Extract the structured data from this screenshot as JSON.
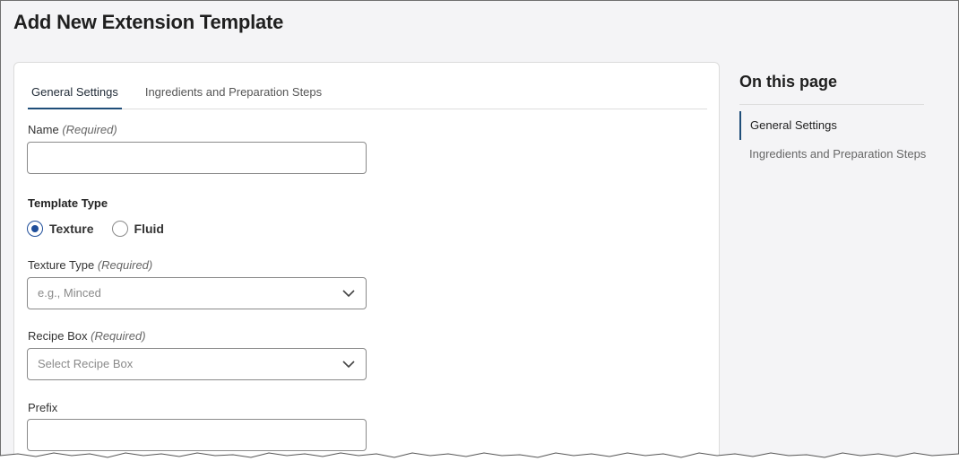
{
  "page": {
    "title": "Add New Extension Template"
  },
  "tabs": [
    {
      "label": "General Settings",
      "active": true
    },
    {
      "label": "Ingredients and Preparation Steps",
      "active": false
    }
  ],
  "form": {
    "name": {
      "label": "Name",
      "required": "(Required)",
      "value": ""
    },
    "template_type": {
      "label": "Template Type",
      "options": [
        {
          "label": "Texture",
          "selected": true
        },
        {
          "label": "Fluid",
          "selected": false
        }
      ]
    },
    "texture_type": {
      "label": "Texture Type",
      "required": "(Required)",
      "placeholder": "e.g., Minced"
    },
    "recipe_box": {
      "label": "Recipe Box",
      "required": "(Required)",
      "placeholder": "Select Recipe Box"
    },
    "prefix": {
      "label": "Prefix",
      "value": ""
    }
  },
  "toc": {
    "title": "On this page",
    "items": [
      {
        "label": "General Settings",
        "active": true
      },
      {
        "label": "Ingredients and Preparation Steps",
        "active": false
      }
    ]
  },
  "colors": {
    "accent": "#1f4e9a",
    "background": "#f4f4f6",
    "card": "#ffffff"
  },
  "icons": {
    "select_arrow": "chevron-down-icon"
  }
}
